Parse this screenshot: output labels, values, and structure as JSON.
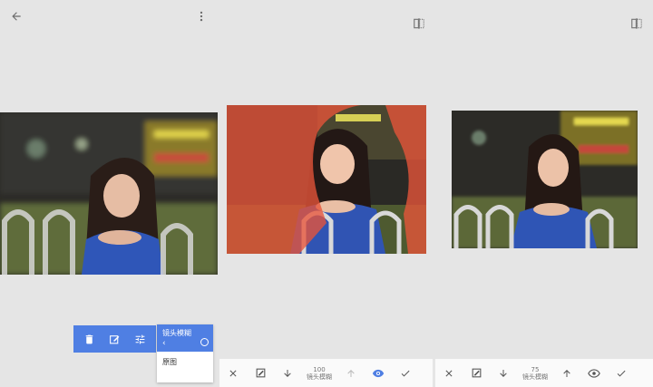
{
  "top_bar": {
    "back_icon": "arrow-left-icon",
    "menu_icon": "more-vert-icon",
    "compare_icon": "compare-icon"
  },
  "action_bar": {
    "icons": [
      "trash-icon",
      "edit-icon",
      "tune-icon"
    ],
    "color": "#4f7fe3"
  },
  "edit_stack": {
    "header_label": "镜头模糊",
    "item_label": "原图"
  },
  "toolbar_1": {
    "value": "100",
    "label": "镜头模糊"
  },
  "toolbar_2": {
    "value": "75",
    "label": "镜头模糊"
  },
  "colors": {
    "accent": "#4f7fe3",
    "mask_overlay": "#e8553a"
  }
}
